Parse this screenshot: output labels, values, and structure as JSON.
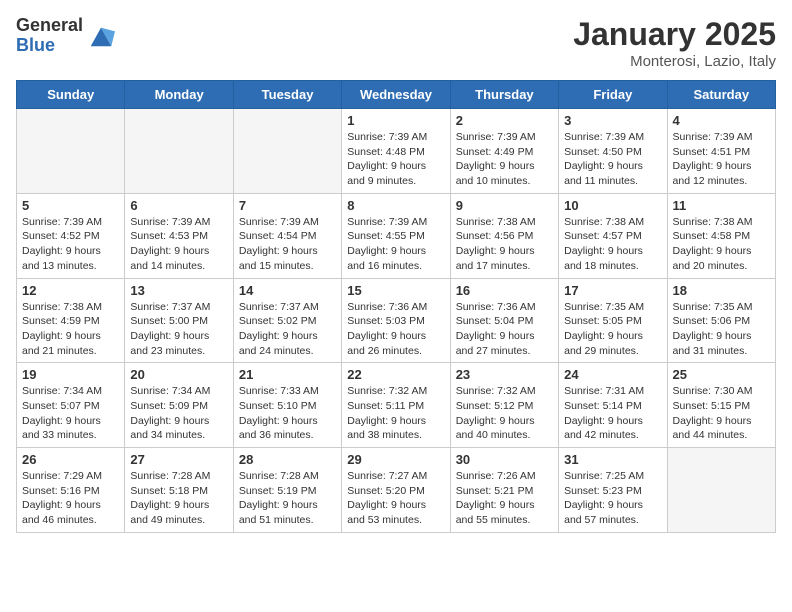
{
  "header": {
    "logo_general": "General",
    "logo_blue": "Blue",
    "month": "January 2025",
    "location": "Monterosi, Lazio, Italy"
  },
  "weekdays": [
    "Sunday",
    "Monday",
    "Tuesday",
    "Wednesday",
    "Thursday",
    "Friday",
    "Saturday"
  ],
  "weeks": [
    [
      {
        "day": "",
        "info": ""
      },
      {
        "day": "",
        "info": ""
      },
      {
        "day": "",
        "info": ""
      },
      {
        "day": "1",
        "info": "Sunrise: 7:39 AM\nSunset: 4:48 PM\nDaylight: 9 hours and 9 minutes."
      },
      {
        "day": "2",
        "info": "Sunrise: 7:39 AM\nSunset: 4:49 PM\nDaylight: 9 hours and 10 minutes."
      },
      {
        "day": "3",
        "info": "Sunrise: 7:39 AM\nSunset: 4:50 PM\nDaylight: 9 hours and 11 minutes."
      },
      {
        "day": "4",
        "info": "Sunrise: 7:39 AM\nSunset: 4:51 PM\nDaylight: 9 hours and 12 minutes."
      }
    ],
    [
      {
        "day": "5",
        "info": "Sunrise: 7:39 AM\nSunset: 4:52 PM\nDaylight: 9 hours and 13 minutes."
      },
      {
        "day": "6",
        "info": "Sunrise: 7:39 AM\nSunset: 4:53 PM\nDaylight: 9 hours and 14 minutes."
      },
      {
        "day": "7",
        "info": "Sunrise: 7:39 AM\nSunset: 4:54 PM\nDaylight: 9 hours and 15 minutes."
      },
      {
        "day": "8",
        "info": "Sunrise: 7:39 AM\nSunset: 4:55 PM\nDaylight: 9 hours and 16 minutes."
      },
      {
        "day": "9",
        "info": "Sunrise: 7:38 AM\nSunset: 4:56 PM\nDaylight: 9 hours and 17 minutes."
      },
      {
        "day": "10",
        "info": "Sunrise: 7:38 AM\nSunset: 4:57 PM\nDaylight: 9 hours and 18 minutes."
      },
      {
        "day": "11",
        "info": "Sunrise: 7:38 AM\nSunset: 4:58 PM\nDaylight: 9 hours and 20 minutes."
      }
    ],
    [
      {
        "day": "12",
        "info": "Sunrise: 7:38 AM\nSunset: 4:59 PM\nDaylight: 9 hours and 21 minutes."
      },
      {
        "day": "13",
        "info": "Sunrise: 7:37 AM\nSunset: 5:00 PM\nDaylight: 9 hours and 23 minutes."
      },
      {
        "day": "14",
        "info": "Sunrise: 7:37 AM\nSunset: 5:02 PM\nDaylight: 9 hours and 24 minutes."
      },
      {
        "day": "15",
        "info": "Sunrise: 7:36 AM\nSunset: 5:03 PM\nDaylight: 9 hours and 26 minutes."
      },
      {
        "day": "16",
        "info": "Sunrise: 7:36 AM\nSunset: 5:04 PM\nDaylight: 9 hours and 27 minutes."
      },
      {
        "day": "17",
        "info": "Sunrise: 7:35 AM\nSunset: 5:05 PM\nDaylight: 9 hours and 29 minutes."
      },
      {
        "day": "18",
        "info": "Sunrise: 7:35 AM\nSunset: 5:06 PM\nDaylight: 9 hours and 31 minutes."
      }
    ],
    [
      {
        "day": "19",
        "info": "Sunrise: 7:34 AM\nSunset: 5:07 PM\nDaylight: 9 hours and 33 minutes."
      },
      {
        "day": "20",
        "info": "Sunrise: 7:34 AM\nSunset: 5:09 PM\nDaylight: 9 hours and 34 minutes."
      },
      {
        "day": "21",
        "info": "Sunrise: 7:33 AM\nSunset: 5:10 PM\nDaylight: 9 hours and 36 minutes."
      },
      {
        "day": "22",
        "info": "Sunrise: 7:32 AM\nSunset: 5:11 PM\nDaylight: 9 hours and 38 minutes."
      },
      {
        "day": "23",
        "info": "Sunrise: 7:32 AM\nSunset: 5:12 PM\nDaylight: 9 hours and 40 minutes."
      },
      {
        "day": "24",
        "info": "Sunrise: 7:31 AM\nSunset: 5:14 PM\nDaylight: 9 hours and 42 minutes."
      },
      {
        "day": "25",
        "info": "Sunrise: 7:30 AM\nSunset: 5:15 PM\nDaylight: 9 hours and 44 minutes."
      }
    ],
    [
      {
        "day": "26",
        "info": "Sunrise: 7:29 AM\nSunset: 5:16 PM\nDaylight: 9 hours and 46 minutes."
      },
      {
        "day": "27",
        "info": "Sunrise: 7:28 AM\nSunset: 5:18 PM\nDaylight: 9 hours and 49 minutes."
      },
      {
        "day": "28",
        "info": "Sunrise: 7:28 AM\nSunset: 5:19 PM\nDaylight: 9 hours and 51 minutes."
      },
      {
        "day": "29",
        "info": "Sunrise: 7:27 AM\nSunset: 5:20 PM\nDaylight: 9 hours and 53 minutes."
      },
      {
        "day": "30",
        "info": "Sunrise: 7:26 AM\nSunset: 5:21 PM\nDaylight: 9 hours and 55 minutes."
      },
      {
        "day": "31",
        "info": "Sunrise: 7:25 AM\nSunset: 5:23 PM\nDaylight: 9 hours and 57 minutes."
      },
      {
        "day": "",
        "info": ""
      }
    ]
  ]
}
